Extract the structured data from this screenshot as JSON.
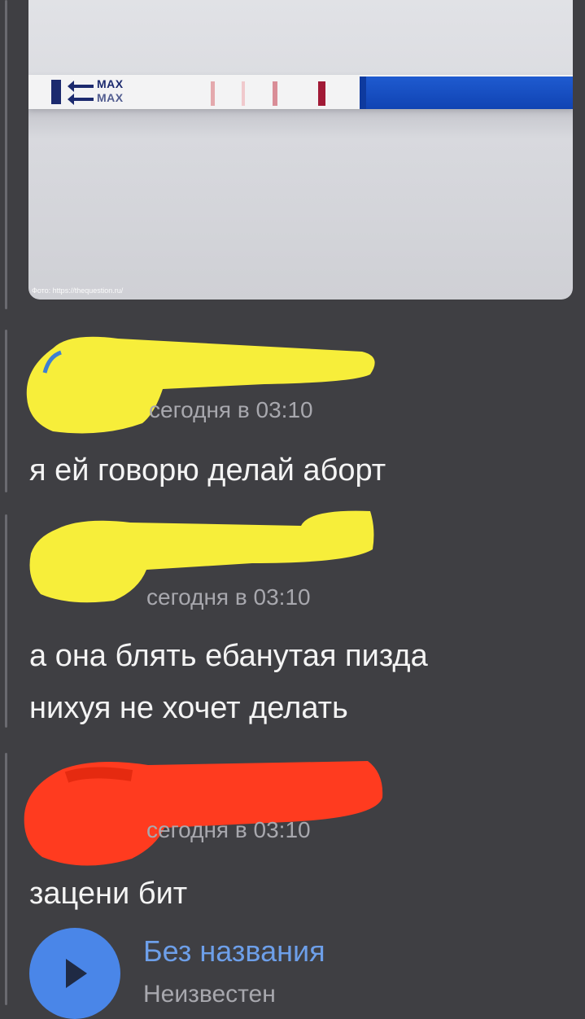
{
  "photo": {
    "strip_label_1": "MAX",
    "strip_label_2": "MAX",
    "credit": "Фото: https://thequestion.ru/"
  },
  "messages": [
    {
      "time": "сегодня в 03:10",
      "text": [
        "я ей говорю делай аборт"
      ],
      "scribble_color": "#f7ee3a"
    },
    {
      "time": "сегодня в 03:10",
      "text": [
        "а она блять ебанутая пизда",
        "нихуя не хочет делать"
      ],
      "scribble_color": "#f7ee3a"
    },
    {
      "time": "сегодня в 03:10",
      "text": [
        "зацени бит"
      ],
      "scribble_color": "#ff3b1f"
    }
  ],
  "audio": {
    "icon": "play-icon",
    "title": "Без названия",
    "artist": "Неизвестен",
    "accent": "#4a86e8"
  }
}
